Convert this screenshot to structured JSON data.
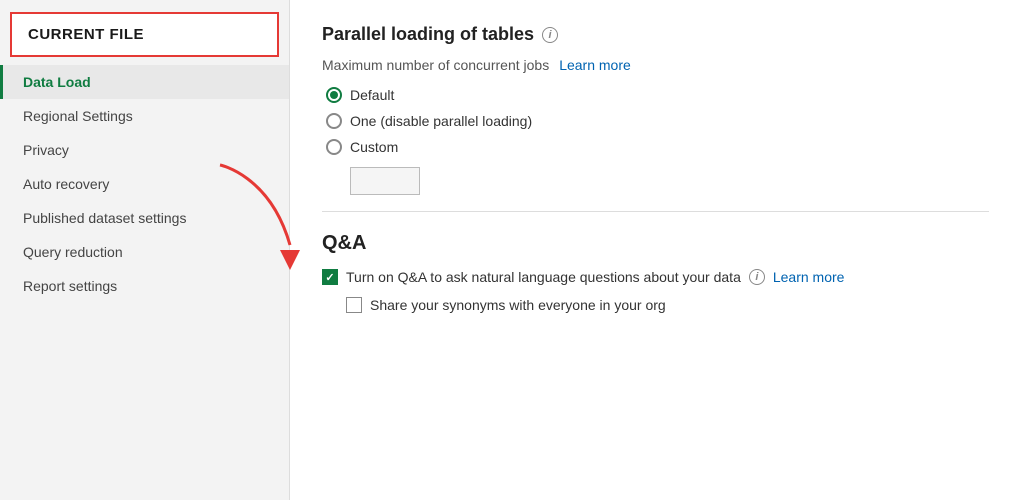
{
  "sidebar": {
    "header": "CURRENT FILE",
    "items": [
      {
        "id": "data-load",
        "label": "Data Load",
        "active": true
      },
      {
        "id": "regional-settings",
        "label": "Regional Settings",
        "active": false
      },
      {
        "id": "privacy",
        "label": "Privacy",
        "active": false
      },
      {
        "id": "auto-recovery",
        "label": "Auto recovery",
        "active": false
      },
      {
        "id": "published-dataset-settings",
        "label": "Published dataset settings",
        "active": false
      },
      {
        "id": "query-reduction",
        "label": "Query reduction",
        "active": false
      },
      {
        "id": "report-settings",
        "label": "Report settings",
        "active": false
      }
    ]
  },
  "main": {
    "section_title": "Parallel loading of tables",
    "max_jobs_label": "Maximum number of concurrent jobs",
    "learn_more_1": "Learn more",
    "learn_more_2": "Learn more",
    "radio_options": [
      {
        "id": "default",
        "label": "Default",
        "selected": true
      },
      {
        "id": "one",
        "label": "One (disable parallel loading)",
        "selected": false
      },
      {
        "id": "custom",
        "label": "Custom",
        "selected": false
      }
    ],
    "qa_title": "Q&A",
    "qa_checkbox_label": "Turn on Q&A to ask natural language questions about your data",
    "synonyms_label": "Share your synonyms with everyone in your org",
    "info_icon_text": "i"
  },
  "colors": {
    "accent_green": "#107c41",
    "link_blue": "#0063b1",
    "border_red": "#e53935"
  }
}
